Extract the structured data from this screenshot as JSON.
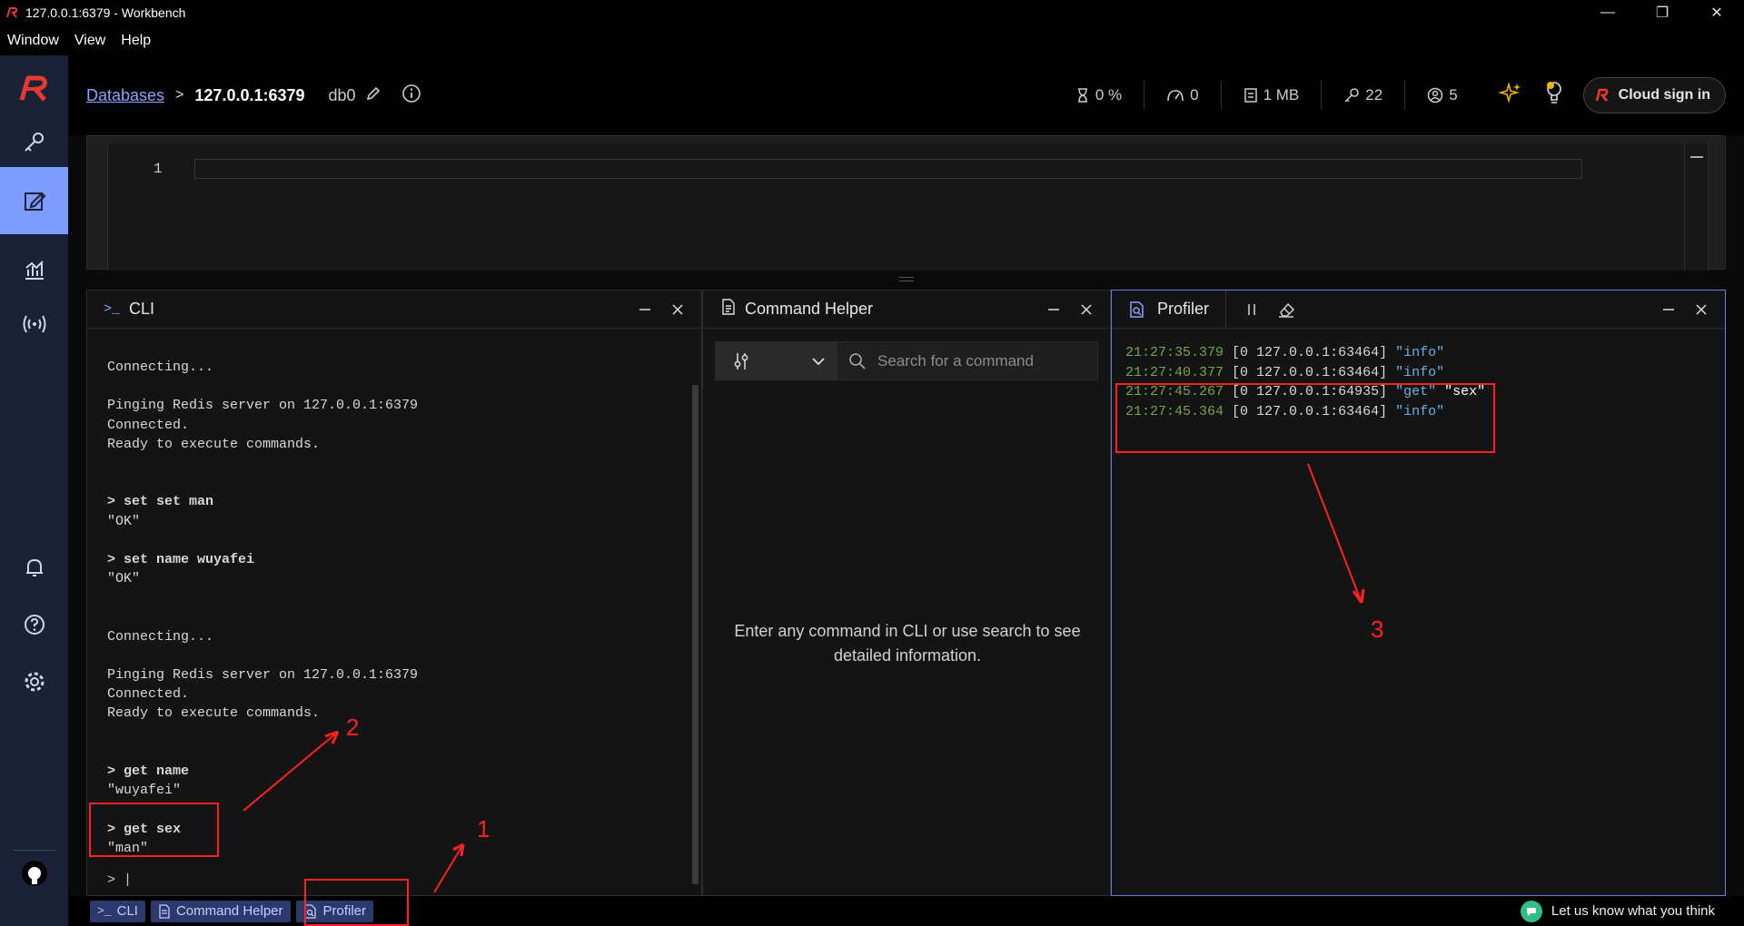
{
  "window": {
    "title": "127.0.0.1:6379 - Workbench"
  },
  "menu": {
    "items": [
      "Window",
      "View",
      "Help"
    ]
  },
  "header": {
    "breadcrumb_link": "Databases",
    "breadcrumb_sep": ">",
    "host": "127.0.0.1:6379",
    "db": "db0",
    "stats": {
      "cpu": "0 %",
      "ops": "0",
      "memory": "1 MB",
      "keys": "22",
      "clients": "5"
    },
    "cloud_signin": "Cloud sign in"
  },
  "editor": {
    "line_number": "1"
  },
  "cli": {
    "title": "CLI",
    "lines": [
      "Connecting...",
      "",
      "Pinging Redis server on 127.0.0.1:6379",
      "Connected.",
      "Ready to execute commands.",
      "",
      "",
      "> set set man",
      "\"OK\"",
      "",
      "> set name wuyafei",
      "\"OK\"",
      "",
      "",
      "Connecting...",
      "",
      "Pinging Redis server on 127.0.0.1:6379",
      "Connected.",
      "Ready to execute commands.",
      "",
      "",
      "> get name",
      "\"wuyafei\"",
      "",
      "> get sex",
      "\"man\""
    ],
    "prompt": "> |"
  },
  "helper": {
    "title": "Command Helper",
    "search_placeholder": "Search for a command",
    "empty_text": "Enter any command in CLI or use search to see detailed information."
  },
  "profiler": {
    "title": "Profiler",
    "entries": [
      {
        "time": "21:27:35.379",
        "meta": "[0 127.0.0.1:63464]",
        "cmd": "\"info\"",
        "arg": ""
      },
      {
        "time": "21:27:40.377",
        "meta": "[0 127.0.0.1:63464]",
        "cmd": "\"info\"",
        "arg": ""
      },
      {
        "time": "21:27:45.267",
        "meta": "[0 127.0.0.1:64935]",
        "cmd": "\"get\"",
        "arg": "\"sex\""
      },
      {
        "time": "21:27:45.364",
        "meta": "[0 127.0.0.1:63464]",
        "cmd": "\"info\"",
        "arg": ""
      }
    ]
  },
  "bottombar": {
    "cli": "CLI",
    "helper": "Command Helper",
    "profiler": "Profiler",
    "feedback": "Let us know what you think"
  },
  "annotations": {
    "one": "1",
    "two": "2",
    "three": "3"
  }
}
